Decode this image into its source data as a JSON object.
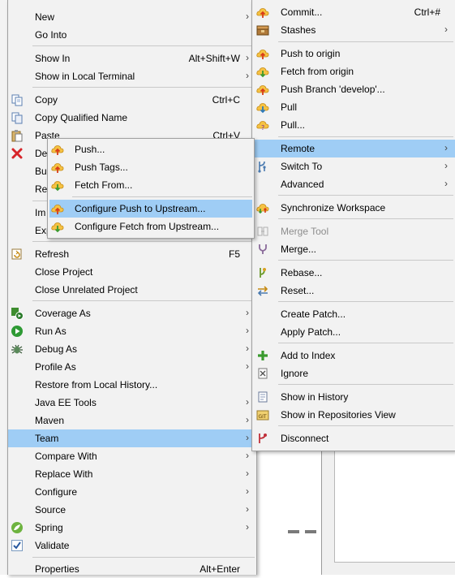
{
  "main_menu": {
    "items": [
      {
        "label": "New",
        "shortcut": "",
        "submenu": true
      },
      {
        "label": "Go Into",
        "shortcut": "",
        "submenu": false
      },
      {
        "label": "Show In",
        "shortcut": "Alt+Shift+W",
        "submenu": true
      },
      {
        "label": "Show in Local Terminal",
        "shortcut": "",
        "submenu": true
      },
      {
        "label": "Copy",
        "shortcut": "Ctrl+C",
        "submenu": false
      },
      {
        "label": "Copy Qualified Name",
        "shortcut": "",
        "submenu": false
      },
      {
        "label": "Paste",
        "shortcut": "Ctrl+V",
        "submenu": false
      },
      {
        "label": "De",
        "shortcut": "",
        "submenu": false
      },
      {
        "label": "Bu",
        "shortcut": "",
        "submenu": false
      },
      {
        "label": "Re",
        "shortcut": "",
        "submenu": false
      },
      {
        "label": "Im",
        "shortcut": "",
        "submenu": false
      },
      {
        "label": "Exp",
        "shortcut": "",
        "submenu": false
      },
      {
        "label": "Refresh",
        "shortcut": "F5",
        "submenu": false
      },
      {
        "label": "Close Project",
        "shortcut": "",
        "submenu": false
      },
      {
        "label": "Close Unrelated Project",
        "shortcut": "",
        "submenu": false
      },
      {
        "label": "Coverage As",
        "shortcut": "",
        "submenu": true
      },
      {
        "label": "Run As",
        "shortcut": "",
        "submenu": true
      },
      {
        "label": "Debug As",
        "shortcut": "",
        "submenu": true
      },
      {
        "label": "Profile As",
        "shortcut": "",
        "submenu": true
      },
      {
        "label": "Restore from Local History...",
        "shortcut": "",
        "submenu": false
      },
      {
        "label": "Java EE Tools",
        "shortcut": "",
        "submenu": true
      },
      {
        "label": "Maven",
        "shortcut": "",
        "submenu": true
      },
      {
        "label": "Team",
        "shortcut": "",
        "submenu": true,
        "selected": true
      },
      {
        "label": "Compare With",
        "shortcut": "",
        "submenu": true
      },
      {
        "label": "Replace With",
        "shortcut": "",
        "submenu": true
      },
      {
        "label": "Configure",
        "shortcut": "",
        "submenu": true
      },
      {
        "label": "Source",
        "shortcut": "",
        "submenu": true
      },
      {
        "label": "Spring",
        "shortcut": "",
        "submenu": true
      },
      {
        "label": "Validate",
        "shortcut": "",
        "submenu": false
      },
      {
        "label": "Properties",
        "shortcut": "Alt+Enter",
        "submenu": false
      }
    ]
  },
  "team_menu": {
    "items": [
      {
        "label": "Commit...",
        "shortcut": "Ctrl+#",
        "submenu": false
      },
      {
        "label": "Stashes",
        "shortcut": "",
        "submenu": true
      },
      {
        "label": "Push to origin",
        "shortcut": "",
        "submenu": false
      },
      {
        "label": "Fetch from origin",
        "shortcut": "",
        "submenu": false
      },
      {
        "label": "Push Branch 'develop'...",
        "shortcut": "",
        "submenu": false
      },
      {
        "label": "Pull",
        "shortcut": "",
        "submenu": false
      },
      {
        "label": "Pull...",
        "shortcut": "",
        "submenu": false
      },
      {
        "label": "Remote",
        "shortcut": "",
        "submenu": true,
        "selected": true
      },
      {
        "label": "Switch To",
        "shortcut": "",
        "submenu": true
      },
      {
        "label": "Advanced",
        "shortcut": "",
        "submenu": true
      },
      {
        "label": "Synchronize Workspace",
        "shortcut": "",
        "submenu": false
      },
      {
        "label": "Merge Tool",
        "shortcut": "",
        "submenu": false,
        "disabled": true
      },
      {
        "label": "Merge...",
        "shortcut": "",
        "submenu": false
      },
      {
        "label": "Rebase...",
        "shortcut": "",
        "submenu": false
      },
      {
        "label": "Reset...",
        "shortcut": "",
        "submenu": false
      },
      {
        "label": "Create Patch...",
        "shortcut": "",
        "submenu": false
      },
      {
        "label": "Apply Patch...",
        "shortcut": "",
        "submenu": false
      },
      {
        "label": "Add to Index",
        "shortcut": "",
        "submenu": false
      },
      {
        "label": "Ignore",
        "shortcut": "",
        "submenu": false
      },
      {
        "label": "Show in History",
        "shortcut": "",
        "submenu": false
      },
      {
        "label": "Show in Repositories View",
        "shortcut": "",
        "submenu": false
      },
      {
        "label": "Disconnect",
        "shortcut": "",
        "submenu": false
      }
    ]
  },
  "remote_menu": {
    "items": [
      {
        "label": "Push...",
        "selected": false
      },
      {
        "label": "Push Tags...",
        "selected": false
      },
      {
        "label": "Fetch From...",
        "selected": false
      },
      {
        "label": "Configure Push to Upstream...",
        "selected": true
      },
      {
        "label": "Configure Fetch from Upstream...",
        "selected": false
      }
    ]
  },
  "icons": {
    "copy": "copy-icon",
    "copy_qualified": "copy-qualified-name-icon",
    "paste": "paste-icon",
    "delete": "delete-icon",
    "refresh": "refresh-icon",
    "coverage": "coverage-icon",
    "run": "run-icon",
    "debug": "debug-icon",
    "spring": "spring-icon",
    "validate": "validate-check-icon",
    "commit": "commit-icon",
    "stashes": "stashes-icon",
    "push": "push-icon",
    "fetch": "fetch-icon",
    "pull": "pull-icon",
    "switch": "switch-branch-icon",
    "synchronize": "synchronize-icon",
    "merge_tool": "merge-tool-icon",
    "merge": "merge-icon",
    "rebase": "rebase-icon",
    "reset": "reset-icon",
    "add_index": "add-to-index-icon",
    "ignore": "ignore-icon",
    "history": "history-icon",
    "repositories": "git-repositories-icon",
    "disconnect": "disconnect-icon"
  },
  "colors": {
    "menu_background": "#f2f2f2",
    "selection": "#9fcdf5",
    "separator": "#c9c9c9",
    "disabled_text": "#8d8d8d",
    "git_cloud": "#f6c243",
    "push_arrow": "#d83b1a",
    "fetch_arrow": "#3b9a2e"
  }
}
